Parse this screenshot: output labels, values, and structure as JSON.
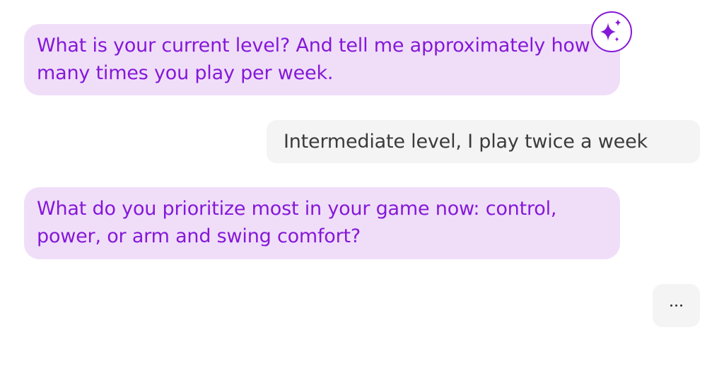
{
  "conversation": {
    "messages": [
      {
        "role": "assistant",
        "text": "What is your current level? And tell me approximately how many times you play per week."
      },
      {
        "role": "user",
        "text": "Intermediate level, I play twice a week"
      },
      {
        "role": "assistant",
        "text": "What do you prioritize most in your game now: control, power, or arm and swing comfort?"
      }
    ],
    "typing_indicator": "...",
    "assistant_icon": "sparkle-icon"
  },
  "colors": {
    "assistant_bubble": "#f0def9",
    "assistant_text": "#8518d8",
    "user_bubble": "#f4f4f4",
    "user_text": "#3b3b3b",
    "accent": "#8518d8"
  }
}
